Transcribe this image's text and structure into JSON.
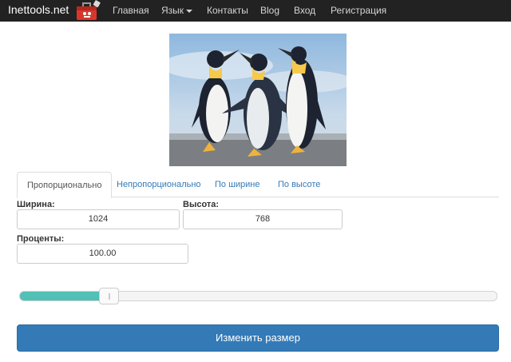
{
  "nav": {
    "brand": "Inettools.net",
    "items": [
      {
        "label": "Главная"
      },
      {
        "label": "Язык"
      },
      {
        "label": "Контакты"
      },
      {
        "label": "Blog"
      },
      {
        "label": "Вход"
      },
      {
        "label": "Регистрация"
      }
    ]
  },
  "tabs": [
    {
      "label": "Пропорционально",
      "active": true
    },
    {
      "label": "Непропорционально"
    },
    {
      "label": "По ширине"
    },
    {
      "label": "По высоте"
    }
  ],
  "form": {
    "width_label": "Ширина:",
    "width_value": "1024",
    "height_label": "Высота:",
    "height_value": "768",
    "percent_label": "Проценты:",
    "percent_value": "100.00"
  },
  "slider": {
    "fill_fraction": 0.166,
    "fill_color": "#51c0b5"
  },
  "submit_label": "Изменить размер",
  "colors": {
    "navbar": "#222222",
    "primary": "#337ab7",
    "link": "#337ab7"
  },
  "icons": {
    "logo": "toolbox-logo-icon",
    "language_caret": "caret-down-icon",
    "slider_handle": "grip-icon"
  }
}
